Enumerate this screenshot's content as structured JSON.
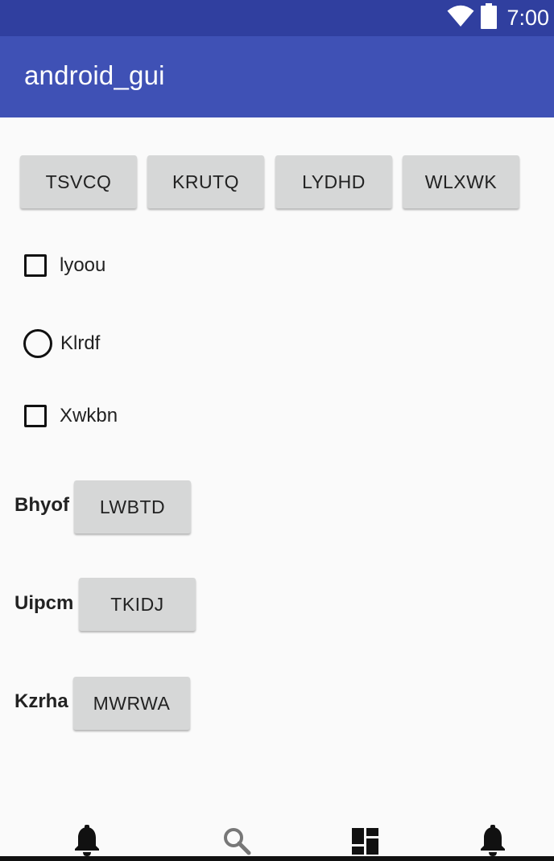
{
  "status_bar": {
    "time": "7:00",
    "icons": [
      "wifi-icon",
      "battery-icon"
    ]
  },
  "app_bar": {
    "title": "android_gui"
  },
  "top_buttons": [
    {
      "label": "TSVCQ"
    },
    {
      "label": "KRUTQ"
    },
    {
      "label": "LYDHD"
    },
    {
      "label": "WLXWK"
    }
  ],
  "options": [
    {
      "type": "checkbox",
      "label": "lyoou",
      "checked": false
    },
    {
      "type": "radio",
      "label": "Klrdf",
      "checked": false
    },
    {
      "type": "checkbox",
      "label": "Xwkbn",
      "checked": false
    }
  ],
  "labeled_buttons": [
    {
      "label": "Bhyof",
      "button": "LWBTD"
    },
    {
      "label": "Uipcm",
      "button": "TKIDJ"
    },
    {
      "label": "Kzrha",
      "button": "MWRWA"
    }
  ],
  "bottom_nav": [
    {
      "icon": "bell-icon"
    },
    {
      "icon": "search-icon"
    },
    {
      "icon": "dashboard-icon"
    },
    {
      "icon": "bell-icon"
    }
  ],
  "colors": {
    "status_bar": "#303f9f",
    "app_bar": "#3f51b5",
    "button": "#d6d7d7",
    "background": "#fafafa"
  }
}
